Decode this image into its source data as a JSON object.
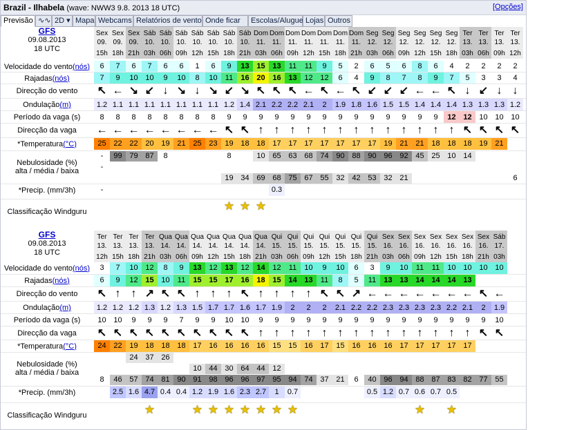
{
  "header": {
    "location": "Brazil - Ilhabela",
    "wave_info": "(wave: NWW3 9.8. 2013 18 UTC)",
    "options_link": "[Opções]"
  },
  "tabs": [
    {
      "label": "Previsão",
      "active": true
    },
    {
      "label": "∿∿"
    },
    {
      "label": "2D ▾"
    },
    {
      "label": "Mapa"
    },
    {
      "label": "Webcams"
    },
    {
      "label": "Relatórios de vento"
    },
    {
      "label": "Onde ficar"
    },
    {
      "label": "Escolas/Aluguer"
    },
    {
      "label": "Lojas"
    },
    {
      "label": "Outros"
    }
  ],
  "row_labels": {
    "wind": "Velocidade do vento",
    "wind_unit": "(nós)",
    "gust": "Rajadas",
    "gust_unit": "(nós)",
    "wind_dir": "Direcção do vento",
    "swell": "Ondulação",
    "swell_unit": "(m)",
    "period": "Período da vaga (s)",
    "wave_dir": "Direcção da vaga",
    "temp": "*Temperatura",
    "temp_unit": "(°C)",
    "cloud1": "Nebulosidade (%)",
    "cloud2": "alta / média / baixa",
    "precip": "*Precip. (mm/3h)",
    "rating": "Classificação Windguru"
  },
  "colors": {
    "wind_scale": [
      "#ffffff",
      "#e0ffff",
      "#9ef6f6",
      "#6ff2df",
      "#4fe98a",
      "#28d828",
      "#9fef2f",
      "#f4f400"
    ],
    "temp_scale": [
      "#ff8000",
      "#ffa020",
      "#ffc040",
      "#ffd060",
      "#ffe080"
    ],
    "cloud_scale": [
      "#ffffff",
      "#e4e4e4",
      "#c4c4c4",
      "#a2a2a2",
      "#888888"
    ],
    "header_dark": "#c8c8c8",
    "header_light": "#ececec",
    "star": "#e8c000"
  },
  "blocks": [
    {
      "model": "GFS",
      "date": "09.08.2013",
      "utc": "18 UTC",
      "days": [
        "Sex",
        "Sex",
        "Sex",
        "Sáb",
        "Sáb",
        "Sáb",
        "Sáb",
        "Sáb",
        "Sáb",
        "Sáb",
        "Dom",
        "Dom",
        "Dom",
        "Dom",
        "Dom",
        "Dom",
        "Dom",
        "Seg",
        "Seg",
        "Seg",
        "Seg",
        "Seg",
        "Seg",
        "Ter",
        "Ter",
        "Ter",
        "Ter"
      ],
      "dates": [
        "09.",
        "09.",
        "09.",
        "10.",
        "10.",
        "10.",
        "10.",
        "10.",
        "10.",
        "10.",
        "11.",
        "11.",
        "11.",
        "11.",
        "11.",
        "11.",
        "11.",
        "12.",
        "12.",
        "12.",
        "12.",
        "12.",
        "12.",
        "13.",
        "13.",
        "13.",
        "13."
      ],
      "hours": [
        "15h",
        "18h",
        "21h",
        "03h",
        "06h",
        "09h",
        "12h",
        "15h",
        "18h",
        "21h",
        "03h",
        "06h",
        "09h",
        "12h",
        "15h",
        "18h",
        "21h",
        "03h",
        "06h",
        "09h",
        "12h",
        "15h",
        "18h",
        "03h",
        "06h",
        "09h",
        "12h"
      ],
      "wind": [
        "6",
        "7",
        "6",
        "7",
        "6",
        "6",
        "1",
        "6",
        "9",
        "13",
        "15",
        "13",
        "11",
        "11",
        "9",
        "5",
        "2",
        "6",
        "5",
        "6",
        "8",
        "6",
        "4",
        "2",
        "2",
        "2",
        "2"
      ],
      "gust": [
        "7",
        "9",
        "10",
        "10",
        "9",
        "10",
        "8",
        "10",
        "11",
        "16",
        "20",
        "16",
        "13",
        "12",
        "12",
        "6",
        "4",
        "9",
        "8",
        "7",
        "8",
        "9",
        "7",
        "5",
        "3",
        "3",
        "4"
      ],
      "wind_dir": [
        "↖",
        "←",
        "↘",
        "↙",
        "↓",
        "↘",
        "↓",
        "↘",
        "↙",
        "↘",
        "↖",
        "↖",
        "↖",
        "←",
        "↖",
        "←",
        "↖",
        "↙",
        "↙",
        "↙",
        "←",
        "←",
        "↖",
        "↓",
        "↙",
        "↓",
        "↓"
      ],
      "swell": [
        "1.2",
        "1.1",
        "1.1",
        "1.1",
        "1.1",
        "1.1",
        "1.1",
        "1.1",
        "1.2",
        "1.4",
        "2.1",
        "2.2",
        "2.2",
        "2.1",
        "2",
        "1.9",
        "1.8",
        "1.6",
        "1.5",
        "1.5",
        "1.4",
        "1.4",
        "1.4",
        "1.3",
        "1.3",
        "1.3",
        "1.2"
      ],
      "period": [
        "8",
        "8",
        "8",
        "8",
        "8",
        "8",
        "8",
        "8",
        "9",
        "9",
        "9",
        "9",
        "9",
        "9",
        "9",
        "9",
        "9",
        "9",
        "9",
        "9",
        "9",
        "9",
        "12",
        "12",
        "10",
        "10",
        "10"
      ],
      "wave_dir": [
        "←",
        "←",
        "←",
        "←",
        "←",
        "←",
        "←",
        "←",
        "↖",
        "↖",
        "↑",
        "↑",
        "↑",
        "↑",
        "↑",
        "↑",
        "↑",
        "↑",
        "↑",
        "↑",
        "↑",
        "↑",
        "↑",
        "↖",
        "↖",
        "↖",
        "↖"
      ],
      "temp": [
        "25",
        "22",
        "22",
        "20",
        "19",
        "21",
        "25",
        "23",
        "19",
        "18",
        "18",
        "17",
        "17",
        "17",
        "17",
        "17",
        "17",
        "17",
        "19",
        "21",
        "21",
        "18",
        "18",
        "18",
        "19",
        "21"
      ],
      "cloud_high": [
        "-",
        "99",
        "79",
        "87",
        "8",
        "",
        "",
        "",
        "8",
        "",
        "10",
        "65",
        "63",
        "68",
        "74",
        "90",
        "88",
        "90",
        "96",
        "92",
        "45",
        "25",
        "10",
        "14",
        "",
        "",
        ""
      ],
      "cloud_mid": [
        "-",
        "",
        "",
        "",
        "",
        "",
        "",
        "",
        "",
        "",
        "",
        "",
        "",
        "",
        "",
        "",
        "",
        "",
        "",
        "",
        "",
        "",
        "",
        "",
        "",
        "",
        ""
      ],
      "cloud_low": [
        "",
        "",
        "",
        "",
        "",
        "",
        "",
        "",
        "19",
        "34",
        "69",
        "68",
        "75",
        "67",
        "55",
        "32",
        "42",
        "53",
        "32",
        "21",
        "",
        "",
        "",
        "",
        "",
        "",
        "6"
      ],
      "precip": [
        "-",
        "",
        "",
        "",
        "",
        "",
        "",
        "",
        "",
        "",
        "",
        "0.3",
        "",
        "",
        "",
        "",
        "",
        "",
        "",
        "",
        "",
        "",
        "",
        "",
        "",
        "",
        ""
      ],
      "rating": [
        "",
        "",
        "",
        "",
        "",
        "",
        "",
        "",
        "1",
        "1",
        "1",
        "",
        "",
        "",
        "",
        "",
        "",
        "",
        "",
        "",
        "",
        "",
        "",
        "",
        "",
        "",
        ""
      ]
    },
    {
      "model": "GFS",
      "date": "09.08.2013",
      "utc": "18 UTC",
      "days": [
        "Ter",
        "Ter",
        "Ter",
        "Ter",
        "Qua",
        "Qua",
        "Qua",
        "Qua",
        "Qua",
        "Qua",
        "Qua",
        "Qui",
        "Qui",
        "Qui",
        "Qui",
        "Qui",
        "Qui",
        "Qui",
        "Sex",
        "Sex",
        "Sex",
        "Sex",
        "Sex",
        "Sex",
        "Sex",
        "Sáb"
      ],
      "dates": [
        "13.",
        "13.",
        "13.",
        "13.",
        "14.",
        "14.",
        "14.",
        "14.",
        "14.",
        "14.",
        "14.",
        "15.",
        "15.",
        "15.",
        "15.",
        "15.",
        "15.",
        "15.",
        "16.",
        "16.",
        "16.",
        "16.",
        "16.",
        "16.",
        "16.",
        "17."
      ],
      "hours": [
        "12h",
        "15h",
        "18h",
        "21h",
        "03h",
        "06h",
        "09h",
        "12h",
        "15h",
        "18h",
        "21h",
        "03h",
        "06h",
        "09h",
        "12h",
        "15h",
        "18h",
        "21h",
        "03h",
        "06h",
        "09h",
        "12h",
        "15h",
        "18h",
        "21h",
        "03h"
      ],
      "wind": [
        "3",
        "7",
        "10",
        "12",
        "8",
        "9",
        "13",
        "12",
        "13",
        "12",
        "14",
        "12",
        "11",
        "10",
        "9",
        "10",
        "6",
        "3",
        "9",
        "10",
        "11",
        "11",
        "10",
        "10",
        "10",
        "10"
      ],
      "gust": [
        "6",
        "9",
        "12",
        "15",
        "10",
        "11",
        "15",
        "15",
        "17",
        "16",
        "18",
        "15",
        "14",
        "13",
        "11",
        "8",
        "5",
        "11",
        "13",
        "13",
        "14",
        "14",
        "14",
        "13"
      ],
      "wind_dir": [
        "↖",
        "↑",
        "↑",
        "↗",
        "↖",
        "↖",
        "↑",
        "↑",
        "↑",
        "↖",
        "↑",
        "↑",
        "↑",
        "↑",
        "↖",
        "↖",
        "↗",
        "←",
        "←",
        "←",
        "←",
        "←",
        "←",
        "←",
        "↖",
        "←"
      ],
      "swell": [
        "1.2",
        "1.2",
        "1.2",
        "1.3",
        "1.2",
        "1.3",
        "1.5",
        "1.7",
        "1.7",
        "1.6",
        "1.7",
        "1.9",
        "2",
        "2",
        "2",
        "2.1",
        "2.2",
        "2.2",
        "2.3",
        "2.3",
        "2.3",
        "2.3",
        "2.2",
        "2.1",
        "2",
        "1.9"
      ],
      "period": [
        "10",
        "10",
        "9",
        "9",
        "9",
        "7",
        "9",
        "9",
        "10",
        "10",
        "9",
        "9",
        "9",
        "9",
        "9",
        "9",
        "9",
        "9",
        "9",
        "9",
        "9",
        "9",
        "9",
        "9",
        "9",
        "10"
      ],
      "wave_dir": [
        "↖",
        "↖",
        "↖",
        "↖",
        "↖",
        "↖",
        "↖",
        "↖",
        "↖",
        "↖",
        "↑",
        "↑",
        "↑",
        "↑",
        "↑",
        "↑",
        "↑",
        "↑",
        "↑",
        "↑",
        "↑",
        "↑",
        "↑",
        "↑",
        "↖",
        "↖"
      ],
      "temp": [
        "24",
        "22",
        "19",
        "18",
        "18",
        "18",
        "17",
        "16",
        "16",
        "16",
        "16",
        "15",
        "15",
        "16",
        "17",
        "15",
        "16",
        "16",
        "16",
        "17",
        "17",
        "17",
        "17",
        "17"
      ],
      "cloud_high": [
        "",
        "",
        "24",
        "37",
        "26",
        "",
        "",
        "",
        "",
        "",
        "",
        "",
        "",
        "",
        "",
        "",
        "",
        "",
        "",
        "",
        "",
        "",
        "",
        "",
        "",
        ""
      ],
      "cloud_mid": [
        "",
        "",
        "",
        "",
        "",
        "",
        "10",
        "44",
        "30",
        "64",
        "44",
        "12",
        "",
        "",
        "",
        "",
        "",
        "",
        "",
        "",
        "",
        "",
        "",
        "",
        "",
        ""
      ],
      "cloud_low": [
        "8",
        "46",
        "57",
        "74",
        "81",
        "90",
        "91",
        "98",
        "96",
        "96",
        "97",
        "95",
        "94",
        "74",
        "37",
        "21",
        "6",
        "40",
        "96",
        "94",
        "88",
        "87",
        "83",
        "82",
        "77",
        "55"
      ],
      "precip": [
        "",
        "2.5",
        "1.6",
        "4.7",
        "0.4",
        "0.4",
        "1.2",
        "1.9",
        "1.6",
        "2.3",
        "2.7",
        "1",
        "0.7",
        "",
        "",
        "",
        "",
        "0.5",
        "1.2",
        "0.7",
        "0.6",
        "0.7",
        "0.5",
        "",
        "",
        ""
      ],
      "rating": [
        "",
        "",
        "",
        "1",
        "",
        "",
        "1",
        "1",
        "1",
        "1",
        "1",
        "1",
        "1",
        "",
        "",
        "",
        "",
        "",
        "",
        "",
        "1",
        "",
        "1",
        "",
        "",
        ""
      ]
    }
  ]
}
